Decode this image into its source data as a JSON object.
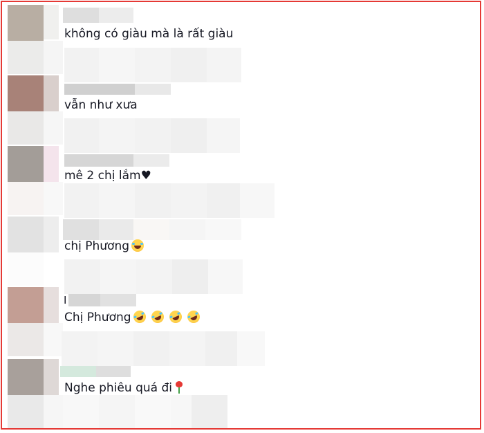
{
  "comments": [
    {
      "text": "không có giàu mà là rất giàu",
      "emoji": []
    },
    {
      "text": "vẫn như xưa",
      "emoji": []
    },
    {
      "text": "mê 2 chị lắm♥",
      "emoji": []
    },
    {
      "text": "chị Phương",
      "emoji": [
        "laughing-face-icon"
      ]
    },
    {
      "text": "Chị Phương",
      "emoji": [
        "rolling-laughing-icon",
        "rolling-laughing-icon",
        "rolling-laughing-icon",
        "rolling-laughing-icon"
      ]
    },
    {
      "text": "Nghe phiêu quá đi",
      "emoji": [
        "rose-icon"
      ]
    }
  ],
  "stray_char": "I",
  "colors": {
    "frame_border": "#e53935",
    "text": "#161823",
    "avatar_1": "#b8aea3",
    "avatar_2": "#a88278",
    "avatar_3": "#a39d98",
    "avatar_4": "#c39e94",
    "avatar_5": "#a8a09b",
    "accent_green": "#d4e9dd",
    "accent_pink": "#f4e4ec"
  }
}
